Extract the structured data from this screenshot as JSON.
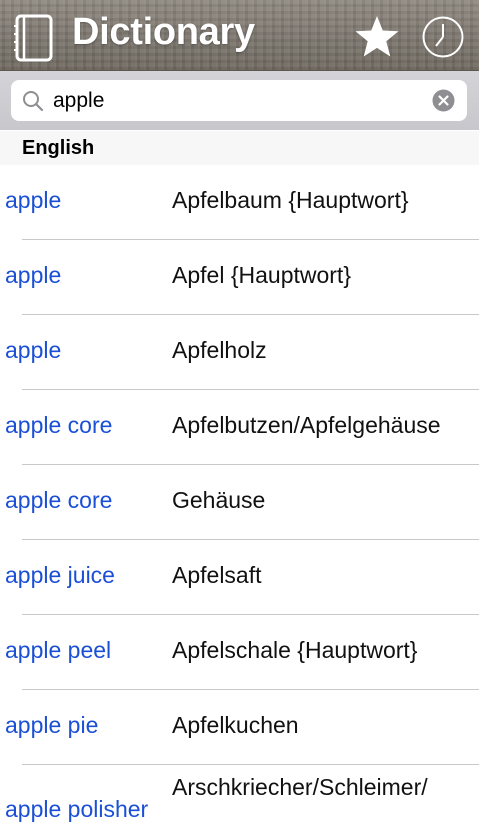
{
  "header": {
    "title": "Dictionary",
    "left_icon": "book-icon",
    "favorites_icon": "star-icon",
    "history_icon": "clock-icon"
  },
  "search": {
    "value": "apple",
    "search_icon": "search-icon",
    "clear_icon": "clear-icon"
  },
  "section": {
    "label": "English"
  },
  "entries": [
    {
      "word": "apple",
      "translation": "Apfelbaum {Hauptwort}"
    },
    {
      "word": "apple",
      "translation": "Apfel {Hauptwort}"
    },
    {
      "word": "apple",
      "translation": "Apfelholz"
    },
    {
      "word": "apple core",
      "translation": "Apfelbutzen/Apfelgehäuse"
    },
    {
      "word": "apple core",
      "translation": "Gehäuse"
    },
    {
      "word": "apple juice",
      "translation": "Apfelsaft"
    },
    {
      "word": "apple peel",
      "translation": "Apfelschale {Hauptwort}"
    },
    {
      "word": "apple pie",
      "translation": "Apfelkuchen"
    },
    {
      "word": "apple polisher",
      "translation": "Arschkriecher/Schleimer/"
    }
  ],
  "colors": {
    "link": "#1a4fd6",
    "header_bg": "#7b756d",
    "search_bg": "#c9c9ce"
  }
}
